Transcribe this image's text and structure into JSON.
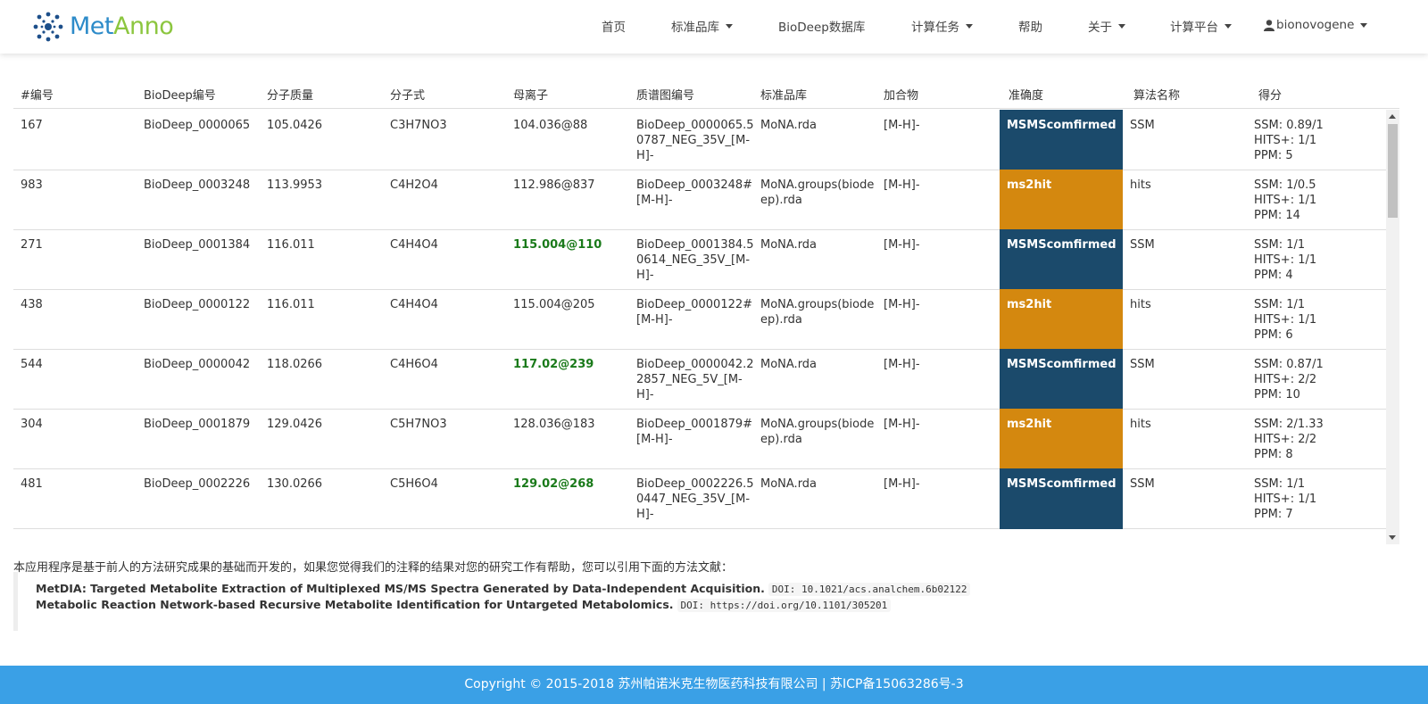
{
  "brand": {
    "part1": "Met",
    "part2": "Anno"
  },
  "nav": {
    "home": "首页",
    "standards": "标准品库",
    "biodeep_db": "BioDeep数据库",
    "tasks": "计算任务",
    "help": "帮助",
    "about": "关于",
    "platform": "计算平台",
    "user": "bionovogene"
  },
  "table": {
    "headers": [
      "#编号",
      "BioDeep编号",
      "分子质量",
      "分子式",
      "母离子",
      "质谱图编号",
      "标准品库",
      "加合物",
      "准确度",
      "算法名称",
      "得分"
    ],
    "rows": [
      {
        "id": "167",
        "biodeep": "BioDeep_0000065",
        "mass": "105.0426",
        "formula": "C3H7NO3",
        "precursor": "104.036@88",
        "precursor_bold": false,
        "spectrum": [
          "BioDeep_0000065.5",
          "0787_NEG_35V_[M-",
          "H]-"
        ],
        "library": [
          "MoNA.rda"
        ],
        "adduct": "[M-H]-",
        "accuracy": "MSMScomfirmed",
        "acc_type": "conf",
        "algorithm": "SSM",
        "score": [
          "SSM: 0.89/1",
          "HITS+: 1/1",
          "PPM: 5"
        ]
      },
      {
        "id": "983",
        "biodeep": "BioDeep_0003248",
        "mass": "113.9953",
        "formula": "C4H2O4",
        "precursor": "112.986@837",
        "precursor_bold": false,
        "spectrum": [
          "BioDeep_0003248#",
          "[M-H]-"
        ],
        "library": [
          "MoNA.groups(biode",
          "ep).rda"
        ],
        "adduct": "[M-H]-",
        "accuracy": "ms2hit",
        "acc_type": "hit",
        "algorithm": "hits",
        "score": [
          "SSM: 1/0.5",
          "HITS+: 1/1",
          "PPM: 14"
        ]
      },
      {
        "id": "271",
        "biodeep": "BioDeep_0001384",
        "mass": "116.011",
        "formula": "C4H4O4",
        "precursor": "115.004@110",
        "precursor_bold": true,
        "spectrum": [
          "BioDeep_0001384.5",
          "0614_NEG_35V_[M-",
          "H]-"
        ],
        "library": [
          "MoNA.rda"
        ],
        "adduct": "[M-H]-",
        "accuracy": "MSMScomfirmed",
        "acc_type": "conf",
        "algorithm": "SSM",
        "score": [
          "SSM: 1/1",
          "HITS+: 1/1",
          "PPM: 4"
        ]
      },
      {
        "id": "438",
        "biodeep": "BioDeep_0000122",
        "mass": "116.011",
        "formula": "C4H4O4",
        "precursor": "115.004@205",
        "precursor_bold": false,
        "spectrum": [
          "BioDeep_0000122#",
          "[M-H]-"
        ],
        "library": [
          "MoNA.groups(biode",
          "ep).rda"
        ],
        "adduct": "[M-H]-",
        "accuracy": "ms2hit",
        "acc_type": "hit",
        "algorithm": "hits",
        "score": [
          "SSM: 1/1",
          "HITS+: 1/1",
          "PPM: 6"
        ]
      },
      {
        "id": "544",
        "biodeep": "BioDeep_0000042",
        "mass": "118.0266",
        "formula": "C4H6O4",
        "precursor": "117.02@239",
        "precursor_bold": true,
        "spectrum": [
          "BioDeep_0000042.2",
          "2857_NEG_5V_[M-",
          "H]-"
        ],
        "library": [
          "MoNA.rda"
        ],
        "adduct": "[M-H]-",
        "accuracy": "MSMScomfirmed",
        "acc_type": "conf",
        "algorithm": "SSM",
        "score": [
          "SSM: 0.87/1",
          "HITS+: 2/2",
          "PPM: 10"
        ]
      },
      {
        "id": "304",
        "biodeep": "BioDeep_0001879",
        "mass": "129.0426",
        "formula": "C5H7NO3",
        "precursor": "128.036@183",
        "precursor_bold": false,
        "spectrum": [
          "BioDeep_0001879#",
          "[M-H]-"
        ],
        "library": [
          "MoNA.groups(biode",
          "ep).rda"
        ],
        "adduct": "[M-H]-",
        "accuracy": "ms2hit",
        "acc_type": "hit",
        "algorithm": "hits",
        "score": [
          "SSM: 2/1.33",
          "HITS+: 2/2",
          "PPM: 8"
        ]
      },
      {
        "id": "481",
        "biodeep": "BioDeep_0002226",
        "mass": "130.0266",
        "formula": "C5H6O4",
        "precursor": "129.02@268",
        "precursor_bold": true,
        "spectrum": [
          "BioDeep_0002226.5",
          "0447_NEG_35V_[M-",
          "H]-"
        ],
        "library": [
          "MoNA.rda"
        ],
        "adduct": "[M-H]-",
        "accuracy": "MSMScomfirmed",
        "acc_type": "conf",
        "algorithm": "SSM",
        "score": [
          "SSM: 1/1",
          "HITS+: 1/1",
          "PPM: 7"
        ]
      }
    ]
  },
  "citation": {
    "intro": "本应用程序是基于前人的方法研究成果的基础而开发的，如果您觉得我们的注释的结果对您的研究工作有帮助，您可以引用下面的方法文献：",
    "refs": [
      {
        "title": "MetDIA: Targeted Metabolite Extraction of Multiplexed MS/MS Spectra Generated by Data-Independent Acquisition.",
        "doi": "DOI: 10.1021/acs.analchem.6b02122"
      },
      {
        "title": "Metabolic Reaction Network-based Recursive Metabolite Identification for Untargeted Metabolomics.",
        "doi": "DOI: https://doi.org/10.1101/305201"
      }
    ]
  },
  "footer": {
    "text": "Copyright © 2015-2018 苏州帕诺米克生物医药科技有限公司 | 苏ICP备15063286号-3"
  },
  "colors": {
    "confirmed": "#1b4a6b",
    "hit": "#d4880f",
    "footer": "#3aa0e6",
    "precursor_bold": "#1a7a1a"
  }
}
